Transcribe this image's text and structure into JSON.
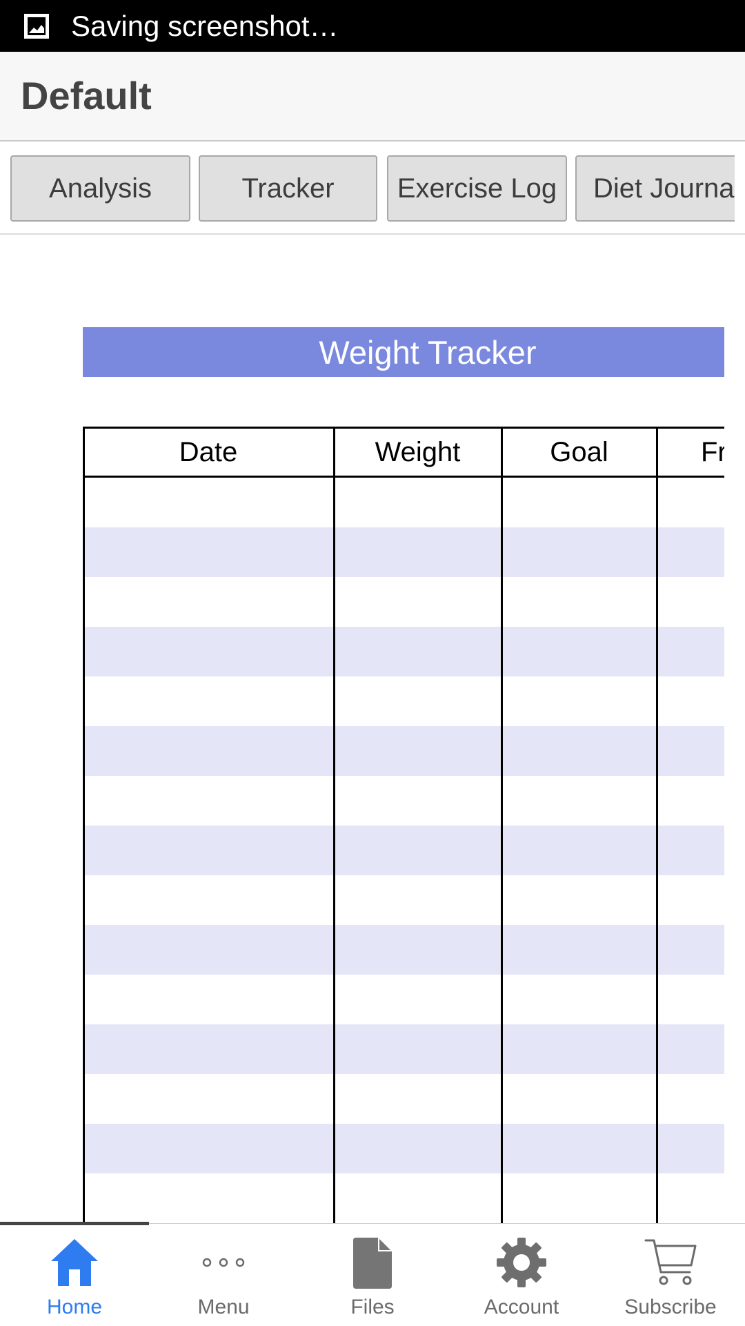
{
  "status_bar": {
    "text": "Saving screenshot…"
  },
  "header": {
    "title": "Default"
  },
  "tabs": [
    {
      "label": "Analysis"
    },
    {
      "label": "Tracker"
    },
    {
      "label": "Exercise Log"
    },
    {
      "label": "Diet Journal"
    }
  ],
  "sheet": {
    "title": "Weight Tracker",
    "title_color": "#7a89de",
    "alt_row_color": "#e4e6f7",
    "columns": [
      {
        "label": "Date"
      },
      {
        "label": "Weight"
      },
      {
        "label": "Goal"
      },
      {
        "label": "Fr"
      }
    ],
    "rows_visible": 15
  },
  "bottom_nav": {
    "active_color": "#2f7cf0",
    "items": [
      {
        "label": "Home",
        "icon": "home-icon",
        "active": true
      },
      {
        "label": "Menu",
        "icon": "more-icon",
        "active": false
      },
      {
        "label": "Files",
        "icon": "file-icon",
        "active": false
      },
      {
        "label": "Account",
        "icon": "gear-icon",
        "active": false
      },
      {
        "label": "Subscribe",
        "icon": "cart-icon",
        "active": false
      }
    ]
  }
}
